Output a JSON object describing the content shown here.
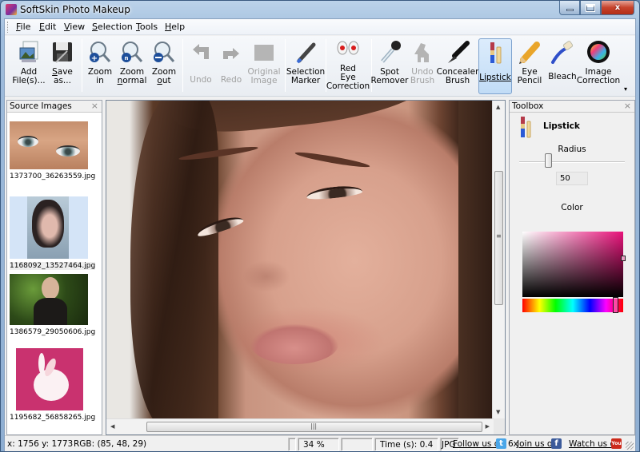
{
  "window": {
    "title": "SoftSkin Photo Makeup",
    "controls": {
      "minimize": "minimize",
      "maximize": "maximize",
      "close": "x"
    }
  },
  "menu": [
    {
      "label": "File",
      "accel": "F",
      "rest": "ile"
    },
    {
      "label": "Edit",
      "accel": "E",
      "rest": "dit"
    },
    {
      "label": "View",
      "accel": "V",
      "rest": "iew"
    },
    {
      "label": "Selection",
      "accel": "S",
      "rest": "election"
    },
    {
      "label": "Tools",
      "accel": "T",
      "rest": "ools"
    },
    {
      "label": "Help",
      "accel": "H",
      "rest": "elp"
    }
  ],
  "toolbar": {
    "buttons": [
      {
        "id": "add-files",
        "line1": "Add",
        "line2": "File(s)...",
        "icon": "add-image-icon",
        "enabled": true
      },
      {
        "id": "save-as",
        "line1": "Save",
        "line2": "as...",
        "icon": "floppy-disk-icon",
        "enabled": true
      },
      {
        "id": "zoom-in",
        "line1": "Zoom",
        "line2": "in",
        "icon": "zoom-in-icon",
        "enabled": true
      },
      {
        "id": "zoom-normal",
        "line1": "Zoom",
        "line2": "normal",
        "icon": "zoom-normal-icon",
        "enabled": true
      },
      {
        "id": "zoom-out",
        "line1": "Zoom",
        "line2": "out",
        "icon": "zoom-out-icon",
        "enabled": true
      },
      {
        "id": "undo",
        "line1": "Undo",
        "line2": "",
        "icon": "undo-arrow-icon",
        "enabled": false
      },
      {
        "id": "redo",
        "line1": "Redo",
        "line2": "",
        "icon": "redo-arrow-icon",
        "enabled": false
      },
      {
        "id": "original-image",
        "line1": "Original",
        "line2": "Image",
        "icon": "original-image-icon",
        "enabled": false
      },
      {
        "id": "selection-marker",
        "line1": "Selection",
        "line2": "Marker",
        "icon": "marker-pen-icon",
        "enabled": true
      },
      {
        "id": "red-eye",
        "line1": "Red",
        "line2": "Eye",
        "line3": "Correction",
        "icon": "red-eye-icon",
        "enabled": true
      },
      {
        "id": "spot-remover",
        "line1": "Spot",
        "line2": "Remover",
        "icon": "pipette-icon",
        "enabled": true
      },
      {
        "id": "undo-brush",
        "line1": "Undo",
        "line2": "Brush",
        "icon": "undo-brush-icon",
        "enabled": false
      },
      {
        "id": "concealer-brush",
        "line1": "Concealer",
        "line2": "Brush",
        "icon": "concealer-brush-icon",
        "enabled": true
      },
      {
        "id": "lipstick",
        "line1": "Lipstick",
        "line2": "",
        "icon": "lipstick-icon",
        "enabled": true,
        "active": true
      },
      {
        "id": "eye-pencil",
        "line1": "Eye",
        "line2": "Pencil",
        "icon": "pencil-icon",
        "enabled": true
      },
      {
        "id": "bleach",
        "line1": "Bleach",
        "line2": "",
        "icon": "toothbrush-icon",
        "enabled": true
      },
      {
        "id": "image-correction",
        "line1": "Image",
        "line2": "Correction",
        "icon": "color-wheel-icon",
        "enabled": true
      }
    ],
    "overflow": "▾"
  },
  "source_images": {
    "title": "Source Images",
    "close": "×",
    "items": [
      {
        "filename": "1373700_36263559.jpg",
        "subject": "eyes closeup",
        "selected": false
      },
      {
        "filename": "1168092_13527464.jpg",
        "subject": "woman portrait",
        "selected": true
      },
      {
        "filename": "1386579_29050606.jpg",
        "subject": "woman in foliage",
        "selected": false
      },
      {
        "filename": "1195682_56858265.jpg",
        "subject": "white rabbit",
        "selected": false
      }
    ]
  },
  "canvas": {
    "subject": "woman face closeup",
    "scroll_up": "▲",
    "scroll_down": "▼",
    "scroll_left": "◀",
    "scroll_right": "▶",
    "grip": "|||"
  },
  "toolbox": {
    "title": "Toolbox",
    "close": "×",
    "tool_name": "Lipstick",
    "radius_label": "Radius",
    "radius_value": "50",
    "radius_slider_fraction": 0.27,
    "color_label": "Color",
    "selected_color": "#e8127a",
    "hue_fraction": 0.92,
    "saturation_fraction": 1.0,
    "value_fraction": 0.6
  },
  "statusbar": {
    "coords": "x: 1756 y: 1773",
    "rgb": "RGB: (85, 48, 29)",
    "zoom": "34 %",
    "time": "Time (s): 0.4",
    "format": "JPG",
    "dims": "6x",
    "follow": "Follow us on",
    "join": "Join us on",
    "watch": "Watch us on",
    "twitter_glyph": "t",
    "facebook_glyph": "f",
    "youtube_glyph": "You"
  }
}
